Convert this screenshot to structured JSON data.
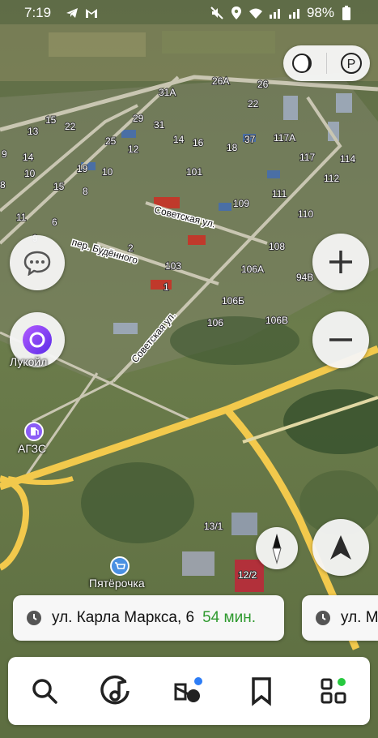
{
  "status_bar": {
    "time": "7:19",
    "battery": "98%"
  },
  "map": {
    "house_numbers": [
      "31А",
      "26А",
      "26",
      "22",
      "15",
      "29",
      "31",
      "13",
      "22",
      "9",
      "14",
      "25",
      "12",
      "14",
      "16",
      "18",
      "37",
      "117А",
      "10",
      "19",
      "10",
      "101",
      "117",
      "114",
      "8",
      "15",
      "8",
      "112",
      "111",
      "109",
      "11",
      "6",
      "110",
      "9",
      "2",
      "108",
      "103",
      "106А",
      "94В",
      "1",
      "106Б",
      "106",
      "106В",
      "13/1",
      "12/2"
    ],
    "streets": [
      "Советская ул.",
      "пер. Будённого",
      "Советская ул."
    ],
    "pois": {
      "lukoil": "Лукойл",
      "azs": "АГЗС",
      "pyaterochka": "Пятёрочка"
    }
  },
  "controls": {
    "layers_icon": "layers-icon",
    "parking_label": "P",
    "zoom_in": "+",
    "zoom_out": "−"
  },
  "route_cards": [
    {
      "address": "ул. Карла Маркса, 6",
      "time": "54 мин."
    },
    {
      "address": "ул. Ма"
    }
  ],
  "toolbar": {
    "items": [
      "search-icon",
      "music-icon",
      "transport-icon",
      "bookmark-icon",
      "services-icon"
    ],
    "badge_colors": {
      "transport": "#2d7df6",
      "services": "#27c93f"
    }
  },
  "colors": {
    "route": "#f2c94c",
    "route_time": "#2f9a2f",
    "alice": "#7b3fe4",
    "pin": "#4a90e2"
  }
}
